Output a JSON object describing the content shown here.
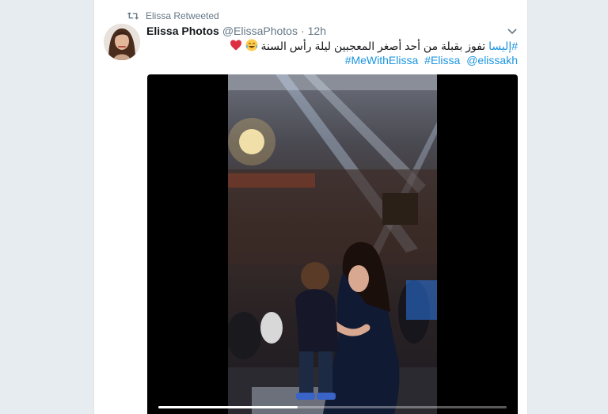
{
  "retweet": {
    "label": "Elissa Retweeted",
    "icon": "retweet-icon"
  },
  "tweet": {
    "author_name": "Elissa Photos",
    "author_handle": "@ElissaPhotos",
    "separator": "·",
    "time": "12h",
    "text_hashtag": "#إليسا",
    "text_body": "تفوز بقبلة من أحد أصغر المعجبين ليلة رأس السنة",
    "emojis": [
      "face-with-tears-of-joy",
      "red-heart"
    ],
    "tags": [
      "#MeWithElissa",
      "#Elissa",
      "@elissakh"
    ]
  },
  "video": {
    "progress": 0.4
  },
  "colors": {
    "link": "#1b95e0",
    "text": "#14171a",
    "muted": "#657786",
    "background": "#e6ecf0"
  }
}
